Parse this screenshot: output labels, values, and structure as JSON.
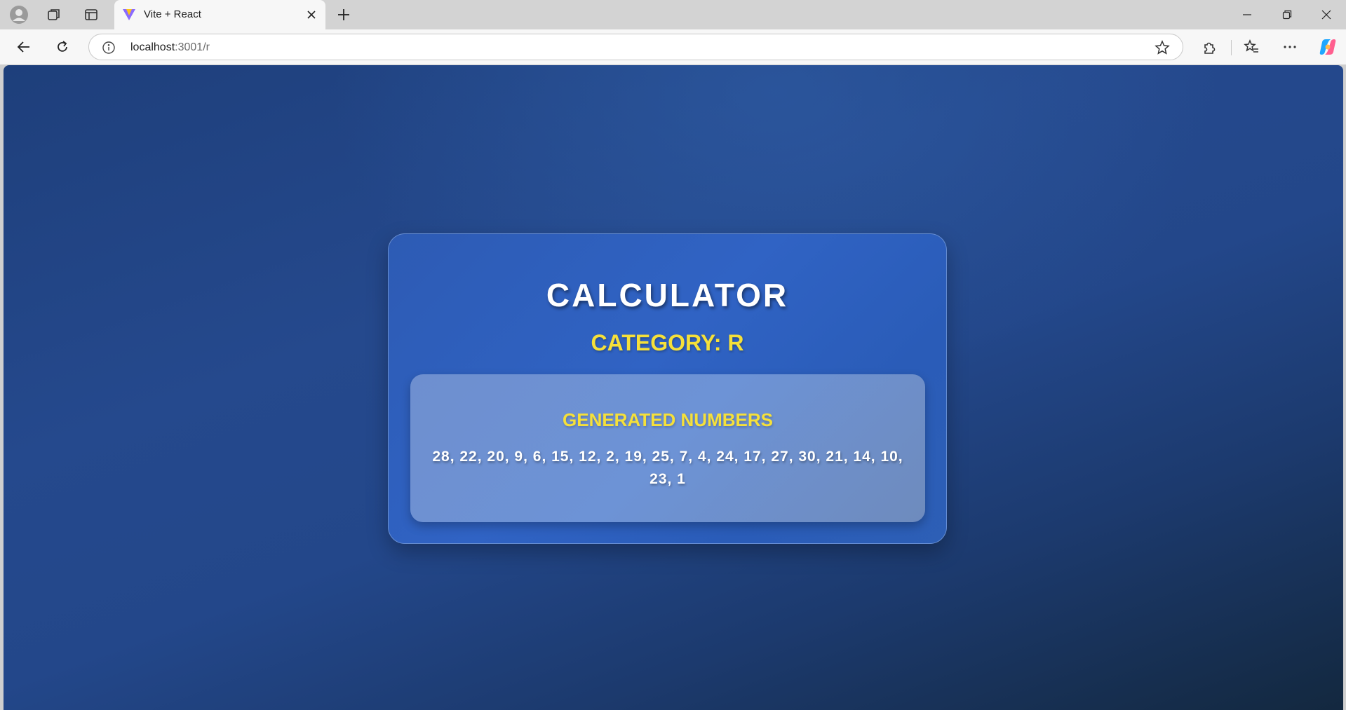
{
  "browser": {
    "tab_title": "Vite + React",
    "address_host": "localhost",
    "address_path": ":3001/r",
    "icons": [
      "profile-icon",
      "workspaces-icon",
      "tab-actions-icon",
      "vite-favicon",
      "close-icon",
      "new-tab-icon",
      "minimize-icon",
      "restore-icon",
      "window-close-icon",
      "back-icon",
      "refresh-icon",
      "info-icon",
      "favorite-star-icon",
      "extensions-icon",
      "favorites-icon",
      "more-icon",
      "copilot-icon"
    ]
  },
  "app": {
    "title": "CALCULATOR",
    "category": "CATEGORY: R",
    "generated_title": "GENERATED NUMBERS",
    "numbers_text": "28, 22, 20, 9, 6, 15, 12, 2, 19, 25, 7, 4, 24, 17, 27, 30, 21, 14, 10, 23, 1"
  },
  "colors": {
    "accent_yellow": "#f5e03a",
    "card_blue": "#3063c4",
    "inner_panel": "#6d93d6"
  }
}
